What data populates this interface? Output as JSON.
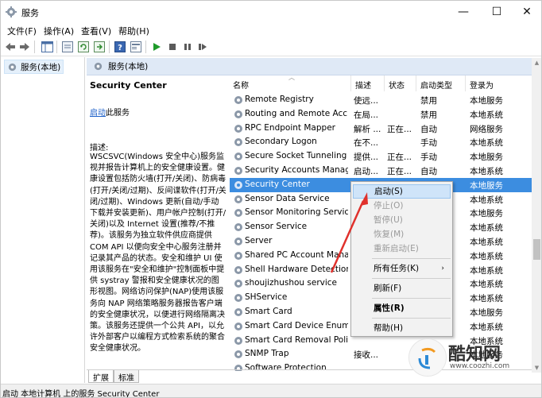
{
  "window": {
    "title": "服务",
    "minimize_glyph": "—",
    "maximize_glyph": "☐",
    "close_glyph": "✕"
  },
  "menu": [
    "文件(F)",
    "操作(A)",
    "查看(V)",
    "帮助(H)"
  ],
  "toolbar_icons": [
    "back-icon",
    "forward-icon",
    "show-tree-icon",
    "console-icon",
    "refresh-icon",
    "export-icon",
    "help-icon",
    "properties-icon",
    "start-icon",
    "stop-icon",
    "pause-icon",
    "restart-icon"
  ],
  "tree": {
    "item": "服务(本地)"
  },
  "pane": {
    "header": "服务(本地)"
  },
  "detail": {
    "service_name": "Security Center",
    "start_link": "启动",
    "start_suffix": "此服务",
    "desc_label": "描述:",
    "description": "WSCSVC(Windows 安全中心)服务监视并报告计算机上的安全健康设置。健康设置包括防火墙(打开/关闭)、防病毒(打开/关闭/过期)、反间谍软件(打开/关闭/过期)、Windows 更新(自动/手动下载并安装更新)、用户帐户控制(打开/关闭)以及 Internet 设置(推荐/不推荐)。该服务为独立软件供应商提供 COM API 以便向安全中心服务注册并记录其产品的状态。安全和维护 UI 使用该服务在\"安全和维护\"控制面板中提供 systray 警报和安全健康状况的图形视图。网络访问保护(NAP)使用该服务向 NAP 网络策略服务器报告客户端的安全健康状况，以便进行网络隔离决策。该服务还提供一个公共 API，以允许外部客户以编程方式检索系统的聚合安全健康状况。"
  },
  "columns": {
    "name": "名称",
    "desc": "描述",
    "status": "状态",
    "startup": "启动类型",
    "logon": "登录为"
  },
  "services": [
    {
      "name": "Remote Registry",
      "desc": "使远...",
      "status": "",
      "startup": "禁用",
      "logon": "本地服务",
      "selected": false
    },
    {
      "name": "Routing and Remote Acc...",
      "desc": "在局...",
      "status": "",
      "startup": "禁用",
      "logon": "本地系统",
      "selected": false
    },
    {
      "name": "RPC Endpoint Mapper",
      "desc": "解析 ...",
      "status": "正在...",
      "startup": "自动",
      "logon": "网络服务",
      "selected": false
    },
    {
      "name": "Secondary Logon",
      "desc": "在不...",
      "status": "",
      "startup": "手动",
      "logon": "本地系统",
      "selected": false
    },
    {
      "name": "Secure Socket Tunneling ...",
      "desc": "提供...",
      "status": "正在...",
      "startup": "手动",
      "logon": "本地服务",
      "selected": false
    },
    {
      "name": "Security Accounts Manag...",
      "desc": "启动...",
      "status": "正在...",
      "startup": "自动",
      "logon": "本地系统",
      "selected": false
    },
    {
      "name": "Security Center",
      "desc": "",
      "status": "",
      "startup": "",
      "logon": "本地服务",
      "selected": true
    },
    {
      "name": "Sensor Data Service",
      "desc": "",
      "status": "",
      "startup": "",
      "logon": "本地系统",
      "selected": false
    },
    {
      "name": "Sensor Monitoring Service",
      "desc": "",
      "status": "",
      "startup": "",
      "logon": "本地服务",
      "selected": false
    },
    {
      "name": "Sensor Service",
      "desc": "",
      "status": "",
      "startup": "",
      "logon": "本地系统",
      "selected": false
    },
    {
      "name": "Server",
      "desc": "",
      "status": "",
      "startup": "",
      "logon": "本地系统",
      "selected": false
    },
    {
      "name": "Shared PC Account Mana...",
      "desc": "",
      "status": "",
      "startup": "",
      "logon": "本地系统",
      "selected": false
    },
    {
      "name": "Shell Hardware Detection",
      "desc": "",
      "status": "",
      "startup": "",
      "logon": "本地系统",
      "selected": false
    },
    {
      "name": "shoujizhushou service",
      "desc": "",
      "status": "",
      "startup": "",
      "logon": "本地系统",
      "selected": false
    },
    {
      "name": "SHService",
      "desc": "",
      "status": "",
      "startup": "",
      "logon": "本地系统",
      "selected": false
    },
    {
      "name": "Smart Card",
      "desc": "",
      "status": "",
      "startup": "",
      "logon": "本地服务",
      "selected": false
    },
    {
      "name": "Smart Card Device Enum...",
      "desc": "",
      "status": "",
      "startup": "",
      "logon": "本地系统",
      "selected": false
    },
    {
      "name": "Smart Card Removal Poli...",
      "desc": "",
      "status": "",
      "startup": "",
      "logon": "本地系统",
      "selected": false
    },
    {
      "name": "SNMP Trap",
      "desc": "接收...",
      "status": "",
      "startup": "",
      "logon": "本地服务",
      "selected": false
    },
    {
      "name": "Software Protection",
      "desc": "",
      "status": "",
      "startup": "",
      "logon": "",
      "selected": false
    }
  ],
  "context_menu": [
    {
      "label": "启动(S)",
      "state": "highlight"
    },
    {
      "label": "停止(O)",
      "state": "disabled"
    },
    {
      "label": "暂停(U)",
      "state": "disabled"
    },
    {
      "label": "恢复(M)",
      "state": "disabled"
    },
    {
      "label": "重新启动(E)",
      "state": "disabled"
    },
    {
      "label": "所有任务(K)",
      "state": "submenu"
    },
    {
      "label": "刷新(F)",
      "state": "normal"
    },
    {
      "label": "属性(R)",
      "state": "bold"
    },
    {
      "label": "帮助(H)",
      "state": "normal"
    }
  ],
  "tabs": [
    "扩展",
    "标准"
  ],
  "statusbar": "启动 本地计算机 上的服务 Security Center",
  "watermark": {
    "name": "酷知网",
    "url": "www.coozhi.com"
  },
  "colors": {
    "selection": "#3c8de0",
    "pane_header": "#dfe9f6",
    "arrow": "#e0312c",
    "menu_highlight": "#cfe4f9"
  }
}
